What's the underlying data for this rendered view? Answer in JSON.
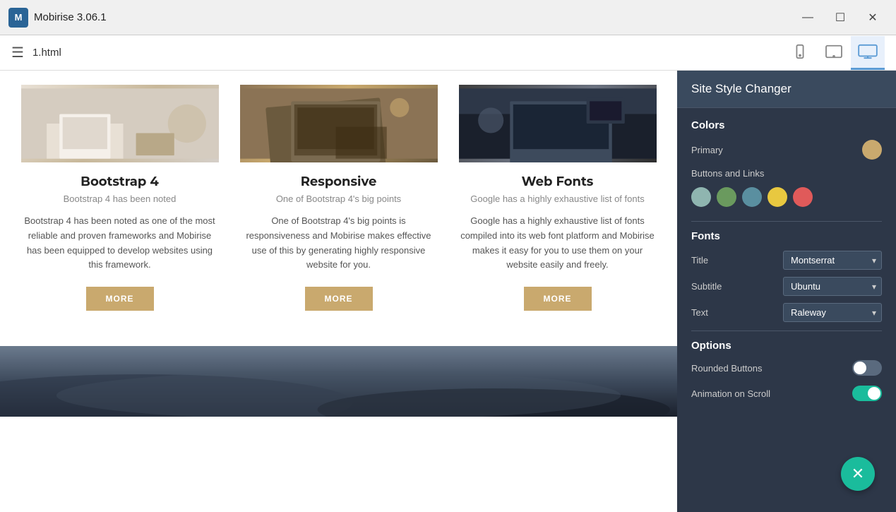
{
  "titleBar": {
    "appIcon": "M",
    "appTitle": "Mobirise 3.06.1",
    "btnMinimize": "—",
    "btnMaximize": "☐",
    "btnClose": "✕"
  },
  "toolbar": {
    "hamburgerIcon": "☰",
    "fileName": "1.html",
    "deviceMobile": "📱",
    "deviceTablet": "📓",
    "deviceDesktop": "🖥"
  },
  "cards": [
    {
      "title": "Bootstrap 4",
      "subtitle": "Bootstrap 4 has been noted",
      "body": "Bootstrap 4 has been noted as one of the most reliable and proven frameworks and Mobirise has been equipped to develop websites using this framework.",
      "btn": "MORE"
    },
    {
      "title": "Responsive",
      "subtitle": "One of Bootstrap 4's big points",
      "body": "One of Bootstrap 4's big points is responsiveness and Mobirise makes effective use of this by generating highly responsive website for you.",
      "btn": "MORE"
    },
    {
      "title": "Web Fonts",
      "subtitle": "Google has a highly exhaustive list of fonts",
      "body": "Google has a highly exhaustive list of fonts compiled into its web font platform and Mobirise makes it easy for you to use them on your website easily and freely.",
      "btn": "MORE"
    }
  ],
  "sidePanel": {
    "header": "Site Style Changer",
    "sections": {
      "colors": {
        "label": "Colors",
        "primaryLabel": "Primary",
        "primaryColor": "#c9a96e",
        "buttonsLinksLabel": "Buttons and Links",
        "swatches": [
          {
            "color": "#8fb5b0",
            "name": "teal-light"
          },
          {
            "color": "#6a9a5e",
            "name": "green"
          },
          {
            "color": "#5a8fa0",
            "name": "steel-blue"
          },
          {
            "color": "#e8c840",
            "name": "yellow"
          },
          {
            "color": "#e05a5a",
            "name": "coral"
          }
        ]
      },
      "fonts": {
        "label": "Fonts",
        "titleLabel": "Title",
        "titleValue": "Montserrat",
        "subtitleLabel": "Subtitle",
        "subtitleValue": "Ubuntu",
        "textLabel": "Text",
        "textValue": "Raleway"
      },
      "options": {
        "label": "Options",
        "roundedButtonsLabel": "Rounded Buttons",
        "roundedButtonsState": "off",
        "animationScrollLabel": "Animation on Scroll",
        "animationScrollState": "on"
      }
    }
  },
  "fab": {
    "icon": "✕"
  }
}
